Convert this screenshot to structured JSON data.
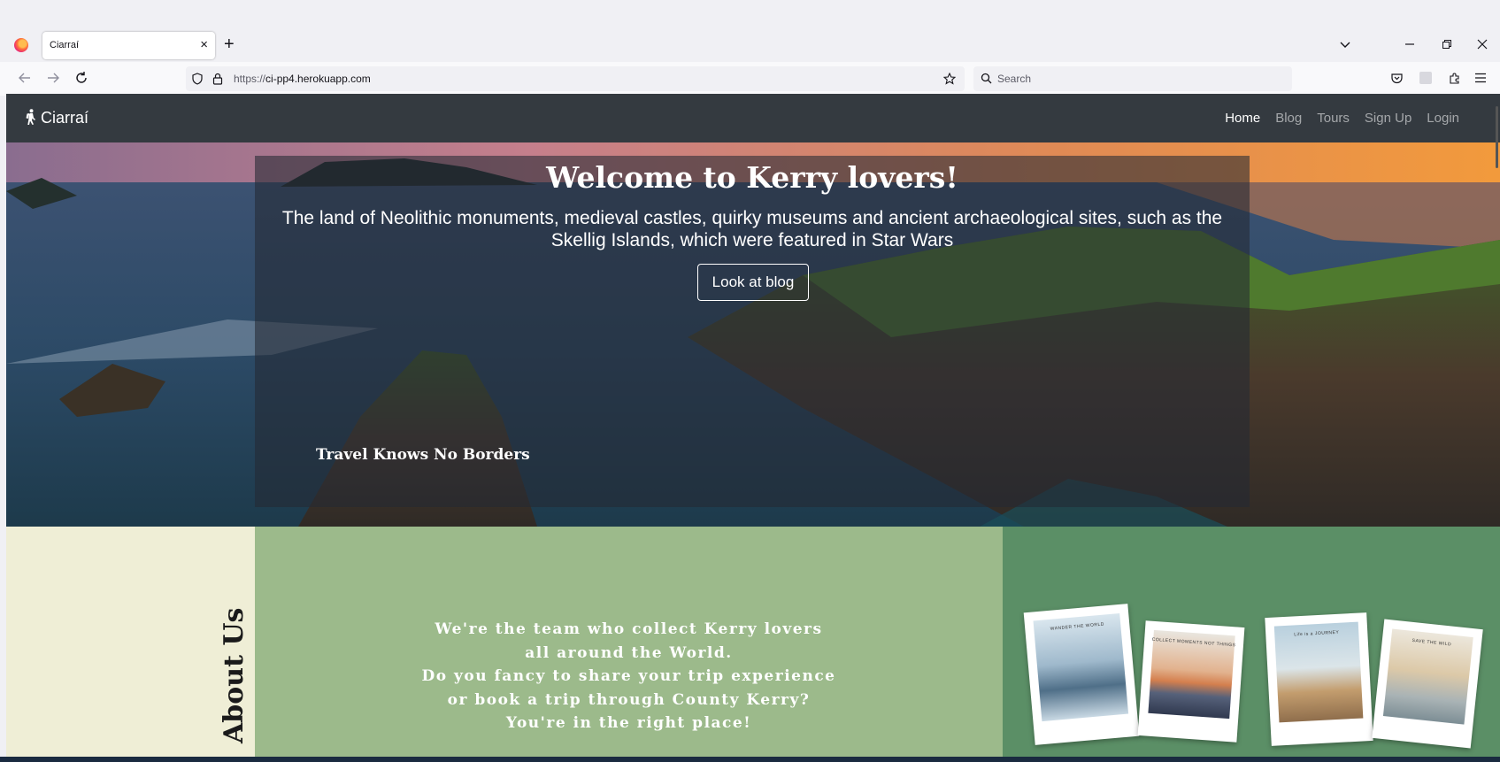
{
  "browser": {
    "tab_title": "Ciarraí",
    "tab_close": "×",
    "new_tab": "+",
    "url_prefix": "https://",
    "url_host": "ci-pp4.herokuapp.com",
    "search_placeholder": "Search",
    "icons": [
      "firefox-logo",
      "back-arrow",
      "forward-arrow",
      "reload",
      "shield",
      "lock",
      "star",
      "search",
      "pocket",
      "extensions",
      "menu",
      "tab-list",
      "minimize",
      "restore",
      "close"
    ]
  },
  "site": {
    "brand": "Ciarraí",
    "nav": [
      {
        "label": "Home",
        "active": true
      },
      {
        "label": "Blog",
        "active": false
      },
      {
        "label": "Tours",
        "active": false
      },
      {
        "label": "Sign Up",
        "active": false
      },
      {
        "label": "Login",
        "active": false
      }
    ]
  },
  "hero": {
    "title": "Welcome to Kerry lovers!",
    "text": "The land of Neolithic monuments, medieval castles, quirky museums and ancient archaeological sites, such as the Skellig Islands, which were featured in Star Wars",
    "button": "Look at blog",
    "tagline": "Travel Knows No Borders"
  },
  "about": {
    "heading": "About Us",
    "lines": [
      "We're the team who collect Kerry lovers",
      "all around the World.",
      "Do you fancy to share your trip experience",
      "or book a trip through County Kerry?",
      "You're in the right place!"
    ],
    "polaroids": [
      {
        "caption": "WANDER THE WORLD"
      },
      {
        "caption": "COLLECT MOMENTS NOT THINGS"
      },
      {
        "caption": "Life is a JOURNEY"
      },
      {
        "caption": "SAVE THE WILD"
      }
    ]
  },
  "colors": {
    "navbar": "#343a40",
    "about_left": "#efeed6",
    "about_mid": "#9cba8b",
    "about_right": "#5b8f66"
  }
}
